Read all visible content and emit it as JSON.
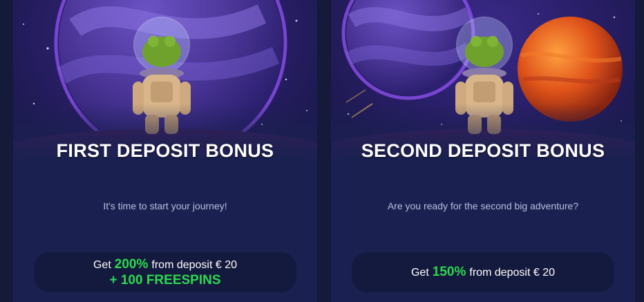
{
  "cards": [
    {
      "title": "FIRST DEPOSIT BONUS",
      "subtitle": "It's time to start your journey!",
      "offer": {
        "prefix": "Get",
        "percent": "200%",
        "suffix": "from deposit € 20",
        "extra": "+ 100 FREESPINS"
      }
    },
    {
      "title": "SECOND DEPOSIT BONUS",
      "subtitle": "Are you ready for the second big adventure?",
      "offer": {
        "prefix": "Get",
        "percent": "150%",
        "suffix": "from deposit € 20"
      }
    }
  ],
  "colors": {
    "background": "#15193a",
    "card": "#1a2150",
    "offer_box": "#141a3d",
    "accent_green": "#2bd94f",
    "subtitle_text": "#b9bfe0"
  }
}
